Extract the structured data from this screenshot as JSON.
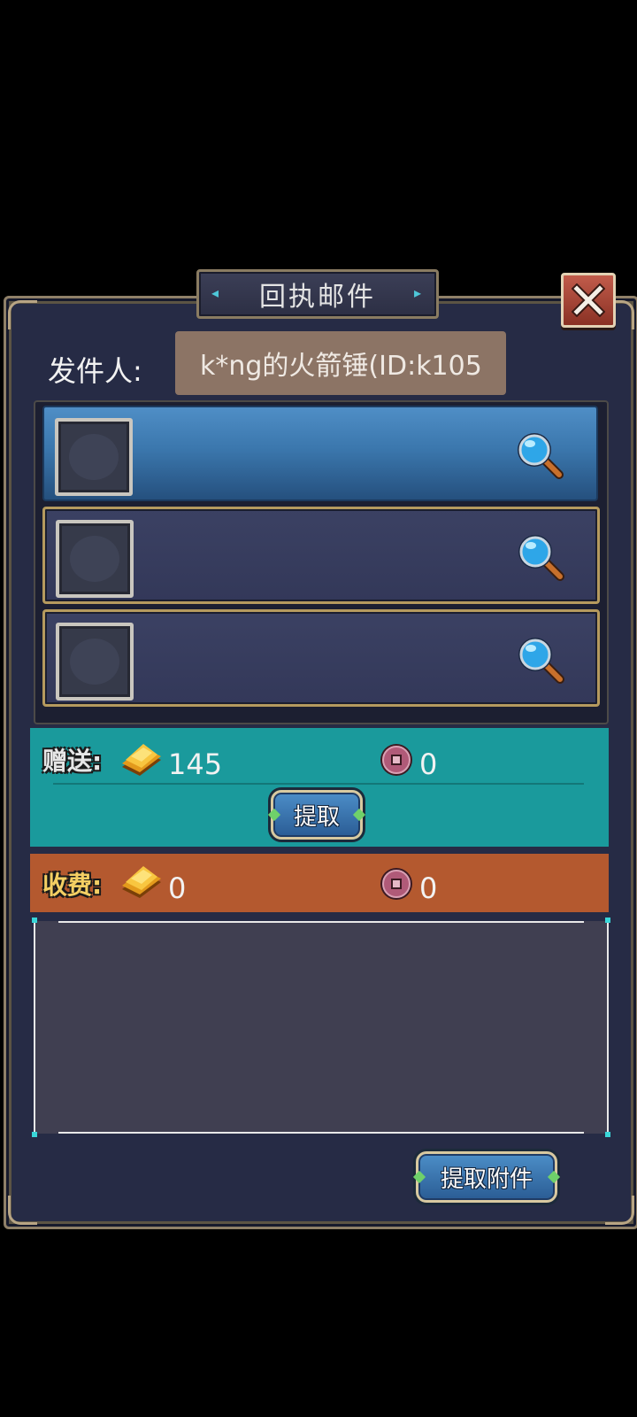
{
  "dialog": {
    "title": "回执邮件",
    "close_icon": "close-x-icon"
  },
  "sender": {
    "label": "发件人:",
    "value": "k*ng的火箭锤(ID:k105"
  },
  "attachments": [
    {
      "selected": true,
      "icon": "magnifier-icon"
    },
    {
      "selected": false,
      "icon": "magnifier-icon"
    },
    {
      "selected": false,
      "icon": "magnifier-icon"
    }
  ],
  "gift": {
    "label": "赠送:",
    "gold_amount": "145",
    "coin_amount": "0",
    "claim_button": "提取"
  },
  "fee": {
    "label": "收费:",
    "gold_amount": "0",
    "coin_amount": "0"
  },
  "footer": {
    "claim_attachments_button": "提取附件"
  },
  "colors": {
    "panel_bg": "#262b45",
    "gift_bg": "#1a9a9c",
    "fee_bg": "#b4592f",
    "selected_row": "#3b77ad"
  }
}
